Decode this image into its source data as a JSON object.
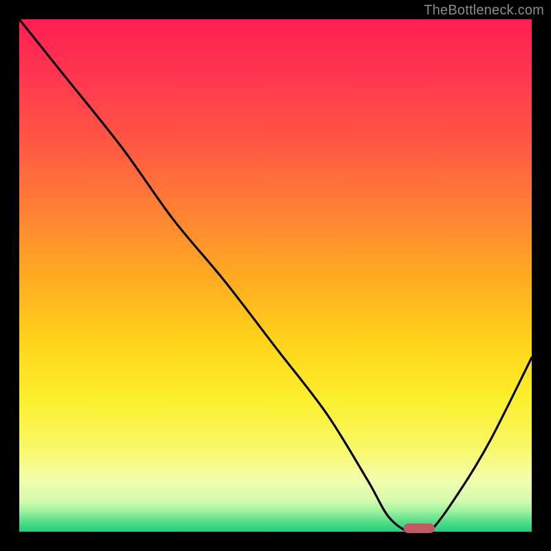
{
  "watermark": "TheBottleneck.com",
  "colors": {
    "frame": "#000000",
    "curve": "#000000",
    "marker": "#c25a63",
    "gradient_top": "#ff1e52",
    "gradient_bottom": "#1ccf79"
  },
  "chart_data": {
    "type": "line",
    "title": "",
    "xlabel": "",
    "ylabel": "",
    "xlim": [
      0,
      100
    ],
    "ylim": [
      0,
      100
    ],
    "grid": false,
    "legend": false,
    "series": [
      {
        "name": "bottleneck-curve",
        "x": [
          0,
          8,
          20,
          30,
          40,
          50,
          60,
          68,
          72,
          76,
          80,
          86,
          92,
          100
        ],
        "values": [
          100,
          90,
          75,
          61,
          49,
          36,
          23,
          10,
          3,
          0,
          0,
          8,
          18,
          34
        ]
      }
    ],
    "marker": {
      "x_center": 78,
      "y": 0,
      "width_pct": 6
    },
    "annotations": []
  }
}
